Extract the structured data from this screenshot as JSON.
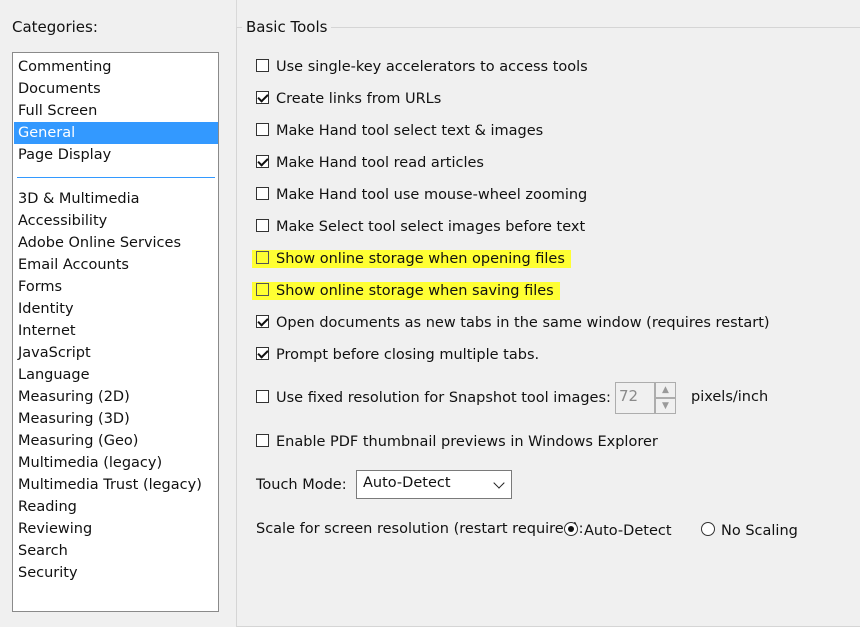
{
  "categories": {
    "label": "Categories:",
    "top_items": [
      "Commenting",
      "Documents",
      "Full Screen",
      "General",
      "Page Display"
    ],
    "selected": "General",
    "items": [
      "3D & Multimedia",
      "Accessibility",
      "Adobe Online Services",
      "Email Accounts",
      "Forms",
      "Identity",
      "Internet",
      "JavaScript",
      "Language",
      "Measuring (2D)",
      "Measuring (3D)",
      "Measuring (Geo)",
      "Multimedia (legacy)",
      "Multimedia Trust (legacy)",
      "Reading",
      "Reviewing",
      "Search",
      "Security"
    ]
  },
  "basic_tools": {
    "title": "Basic Tools",
    "options": [
      {
        "label": "Use single-key accelerators to access tools",
        "checked": false,
        "highlighted": false
      },
      {
        "label": "Create links from URLs",
        "checked": true,
        "highlighted": false
      },
      {
        "label": "Make Hand tool select text & images",
        "checked": false,
        "highlighted": false
      },
      {
        "label": "Make Hand tool read articles",
        "checked": true,
        "highlighted": false
      },
      {
        "label": "Make Hand tool use mouse-wheel zooming",
        "checked": false,
        "highlighted": false
      },
      {
        "label": "Make Select tool select images before text",
        "checked": false,
        "highlighted": false
      },
      {
        "label": "Show online storage when opening files",
        "checked": false,
        "highlighted": true
      },
      {
        "label": "Show online storage when saving files",
        "checked": false,
        "highlighted": true
      },
      {
        "label": "Open documents as new tabs in the same window (requires restart)",
        "checked": true,
        "highlighted": false
      },
      {
        "label": "Prompt before closing multiple tabs.",
        "checked": true,
        "highlighted": false
      }
    ],
    "snapshot": {
      "label": "Use fixed resolution for Snapshot tool images:",
      "checked": false,
      "value": "72",
      "unit": "pixels/inch"
    },
    "thumbnail": {
      "label": "Enable PDF thumbnail previews in Windows Explorer",
      "checked": false
    },
    "touch_mode": {
      "label": "Touch Mode:",
      "value": "Auto-Detect"
    },
    "scale": {
      "label": "Scale for screen resolution (restart required):",
      "options": [
        "Auto-Detect",
        "No Scaling"
      ],
      "selected": "Auto-Detect"
    }
  },
  "colors": {
    "selection": "#3399ff",
    "highlight": "#ffff33"
  }
}
